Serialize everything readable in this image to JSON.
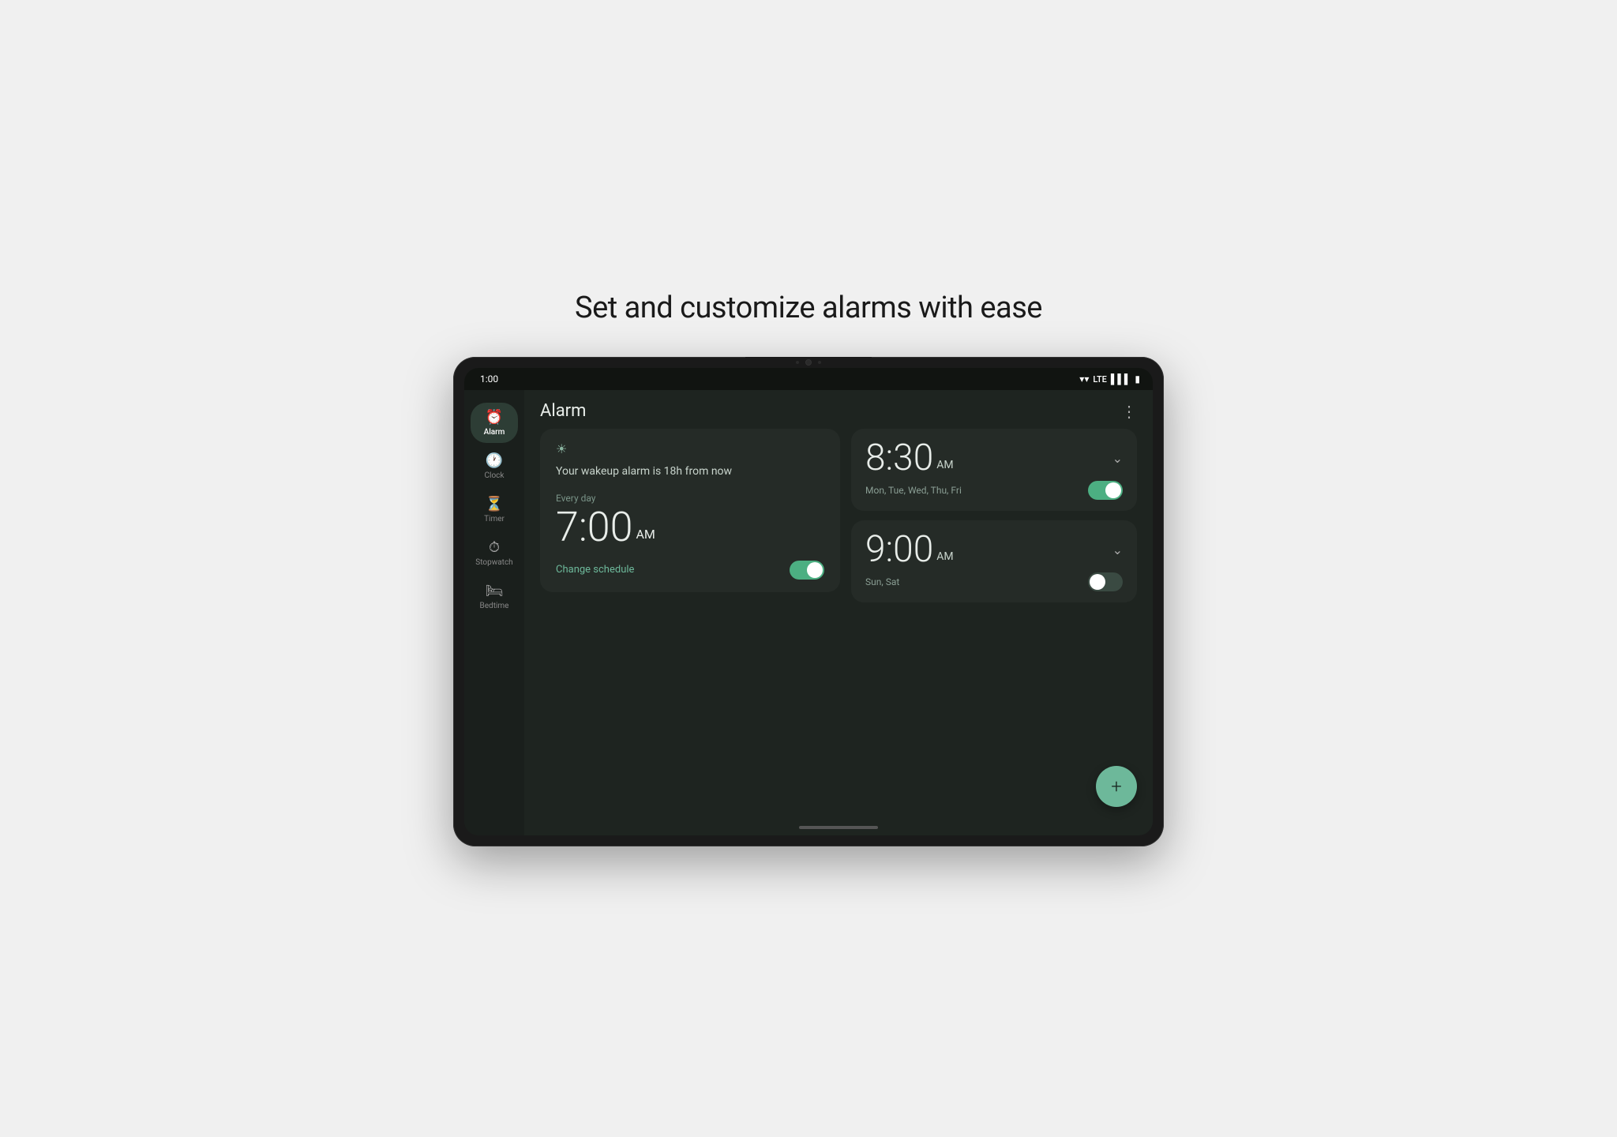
{
  "page": {
    "headline": "Set and customize alarms with ease"
  },
  "status_bar": {
    "time": "1:00",
    "wifi": "📶",
    "lte": "LTE",
    "signal": "📶",
    "battery": "🔋"
  },
  "sidebar": {
    "items": [
      {
        "id": "alarm",
        "label": "Alarm",
        "icon": "⏰",
        "active": true
      },
      {
        "id": "clock",
        "label": "Clock",
        "icon": "🕐",
        "active": false
      },
      {
        "id": "timer",
        "label": "Timer",
        "icon": "⏳",
        "active": false
      },
      {
        "id": "stopwatch",
        "label": "Stopwatch",
        "icon": "⏱",
        "active": false
      },
      {
        "id": "bedtime",
        "label": "Bedtime",
        "icon": "🛏",
        "active": false
      }
    ]
  },
  "header": {
    "title": "Alarm",
    "more_icon": "⋮"
  },
  "wakeup_card": {
    "sun_icon": "☀",
    "message": "Your wakeup alarm is 18h from now",
    "schedule_label": "Every day",
    "time_hour": "7:00",
    "time_suffix": "AM",
    "change_link": "Change schedule",
    "toggle_on": true
  },
  "alarms": [
    {
      "id": "alarm1",
      "time_hour": "8:30",
      "time_suffix": "AM",
      "days": "Mon, Tue, Wed, Thu, Fri",
      "enabled": true
    },
    {
      "id": "alarm2",
      "time_hour": "9:00",
      "time_suffix": "AM",
      "days": "Sun, Sat",
      "enabled": false
    }
  ],
  "fab": {
    "label": "+"
  }
}
